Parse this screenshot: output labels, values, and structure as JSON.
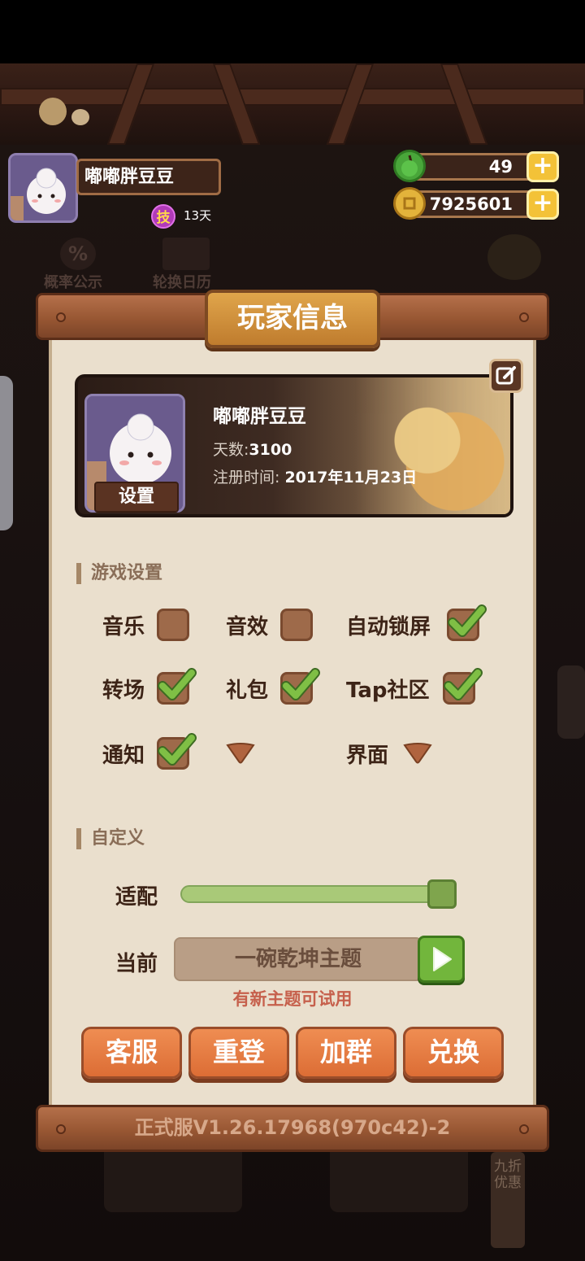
{
  "player": {
    "name": "嘟嘟胖豆豆",
    "skill_badge": "技",
    "days_label": "13天"
  },
  "resources": {
    "apples": "49",
    "coins": "7925601"
  },
  "background_menu": {
    "probability": "概率公示",
    "calendar": "轮换日历",
    "promo": "九折优惠"
  },
  "dialog": {
    "title": "玩家信息",
    "card": {
      "name": "嘟嘟胖豆豆",
      "days_label": "天数:",
      "days_value": "3100",
      "register_label": "注册时间:",
      "register_value": "2017年11月23日",
      "settings_tag": "设置"
    },
    "game_settings": {
      "heading": "游戏设置",
      "options": [
        {
          "label": "音乐",
          "checked": false
        },
        {
          "label": "音效",
          "checked": false
        },
        {
          "label": "自动锁屏",
          "checked": true
        },
        {
          "label": "转场",
          "checked": true
        },
        {
          "label": "礼包",
          "checked": true
        },
        {
          "label": "Tap社区",
          "checked": true
        },
        {
          "label": "通知",
          "checked": true
        }
      ],
      "dropdowns": {
        "ui_label": "界面"
      }
    },
    "custom": {
      "heading": "自定义",
      "fit_label": "适配",
      "fit_value": 1.0,
      "current_label": "当前",
      "theme_name": "一碗乾坤主题",
      "theme_note": "有新主题可试用"
    },
    "buttons": {
      "service": "客服",
      "relogin": "重登",
      "join_group": "加群",
      "redeem": "兑换"
    },
    "version": "正式服V1.26.17968(970c42)-2"
  },
  "colors": {
    "accent_orange": "#dc6d35",
    "check_green": "#7fbf45",
    "paper": "#eadfcd"
  }
}
